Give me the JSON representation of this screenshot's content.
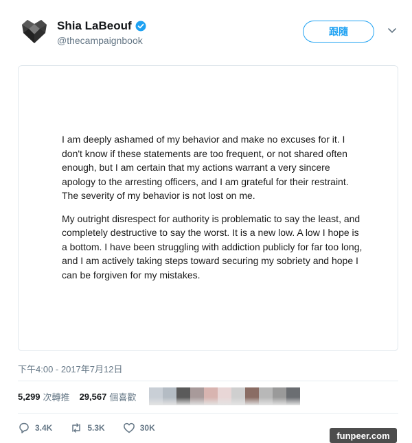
{
  "tweet": {
    "display_name": "Shia LaBeouf",
    "handle": "@thecampaignbook",
    "follow_label": "跟隨",
    "statement": {
      "paragraph1": "I am deeply ashamed of my behavior and make no excuses for it. I don't know if these statements are too frequent, or not shared often enough, but I am certain that my actions warrant a very sincere apology to the arresting officers, and I am grateful for their restraint. The severity of my behavior is not lost on me.",
      "paragraph2": "My outright disrespect for authority is problematic to say the least, and completely destructive to say the worst. It is a new low. A low I hope is a bottom. I have been struggling with addiction publicly for far too long, and I am actively taking steps toward securing my sobriety and hope I can be forgiven for my mistakes."
    },
    "timestamp": "下午4:00 - 2017年7月12日",
    "stats": {
      "retweets_count": "5,299",
      "retweets_label": "次轉推",
      "likes_count": "29,567",
      "likes_label": "個喜歡"
    },
    "actions": {
      "replies": "3.4K",
      "retweets": "5.3K",
      "likes": "30K"
    },
    "liker_avatar_colors": [
      "#c9cfd6",
      "#b4bcc4",
      "#5a5a5a",
      "#a89a9a",
      "#d8b4b0",
      "#e8d6d6",
      "#cfcfcf",
      "#8a6d64",
      "#b8b8b8",
      "#9a9a9a",
      "#6b6e72"
    ]
  },
  "watermark": "funpeer.com",
  "colors": {
    "accent": "#1da1f2",
    "muted": "#657786",
    "text": "#14171a"
  },
  "icons": [
    "verified-badge-icon",
    "chevron-down-icon",
    "reply-icon",
    "retweet-icon",
    "heart-icon",
    "avatar-logo"
  ]
}
